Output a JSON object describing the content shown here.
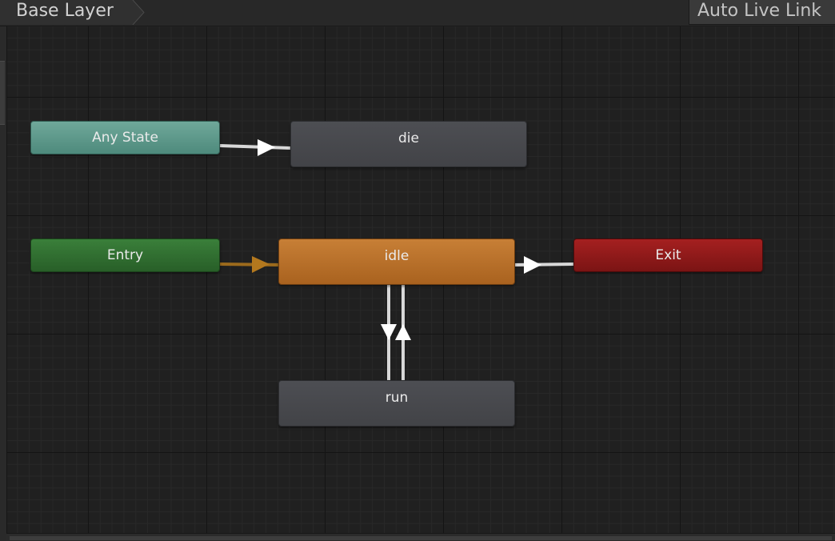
{
  "toolbar": {
    "breadcrumb": "Base Layer",
    "live_link_label": "Auto Live Link"
  },
  "graph": {
    "nodes": {
      "any_state": "Any State",
      "die": "die",
      "entry": "Entry",
      "idle": "idle",
      "exit": "Exit",
      "run": "run"
    },
    "colors": {
      "any_state": "#5e9a8b",
      "entry": "#2f6f2f",
      "exit": "#901a1a",
      "state": "#48494d",
      "default_state": "#b86f2a",
      "transition": "#d8d8d8",
      "entry_transition": "#9c6a1c"
    }
  }
}
